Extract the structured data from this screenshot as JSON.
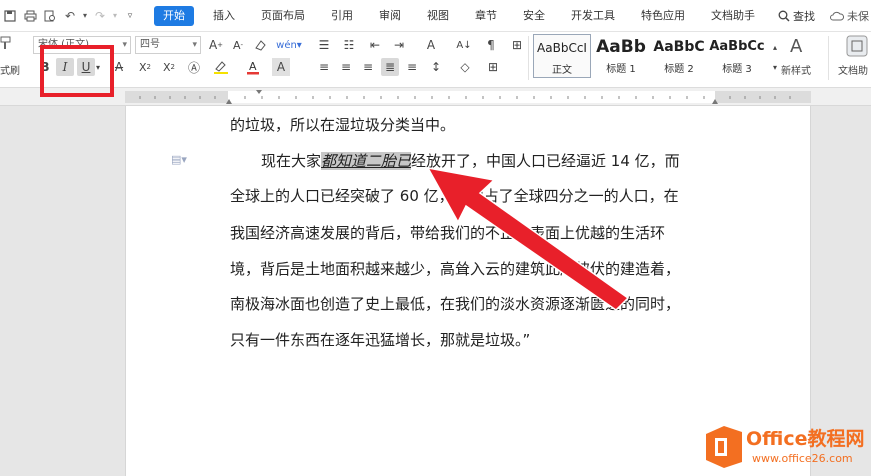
{
  "menubar": {
    "tabs": [
      "开始",
      "插入",
      "页面布局",
      "引用",
      "审阅",
      "视图",
      "章节",
      "安全",
      "开发工具",
      "特色应用",
      "文档助手"
    ],
    "active_tab": "开始",
    "search_label": "查找",
    "unsaved_label": "未保"
  },
  "ribbon": {
    "format_painter_label": "式刷",
    "font_name": "宋体 (正文)",
    "font_size": "四号",
    "styles": [
      {
        "sample": "AaBbCcI",
        "name": "正文"
      },
      {
        "sample": "AaBb",
        "name": "标题 1"
      },
      {
        "sample": "AaBbC",
        "name": "标题 2"
      },
      {
        "sample": "AaBbCc",
        "name": "标题 3"
      }
    ],
    "new_style_label": "新样式",
    "doc_helper_label": "文档助"
  },
  "document": {
    "line1": "的垃圾，所以在湿垃圾分类当中。",
    "line2_before": "现在大家",
    "line2_selected": "都知道二胎已",
    "line2_after": "经放开了，中国人口已经逼近 14 亿，而",
    "line3": "全球上的人口已经突破了 60 亿，我们占了全球四分之一的人口，在",
    "line4": "我国经济高速发展的背后，带给我们的不止是表面上优越的生活环",
    "line5": "境，背后是土地面积越来越少，高耸入云的建筑此起彼伏的建造着，",
    "line6": "南极海冰面也创造了史上最低，在我们的淡水资源逐渐匮乏的同时，",
    "line7": "只有一件东西在逐年迅猛增长，那就是垃圾。”"
  },
  "watermark": {
    "brand": "Office教程网",
    "url": "www.office26.com"
  },
  "colors": {
    "accent_blue": "#1e7be3",
    "annotation_red": "#e8202a",
    "brand_orange": "#f36f21"
  }
}
